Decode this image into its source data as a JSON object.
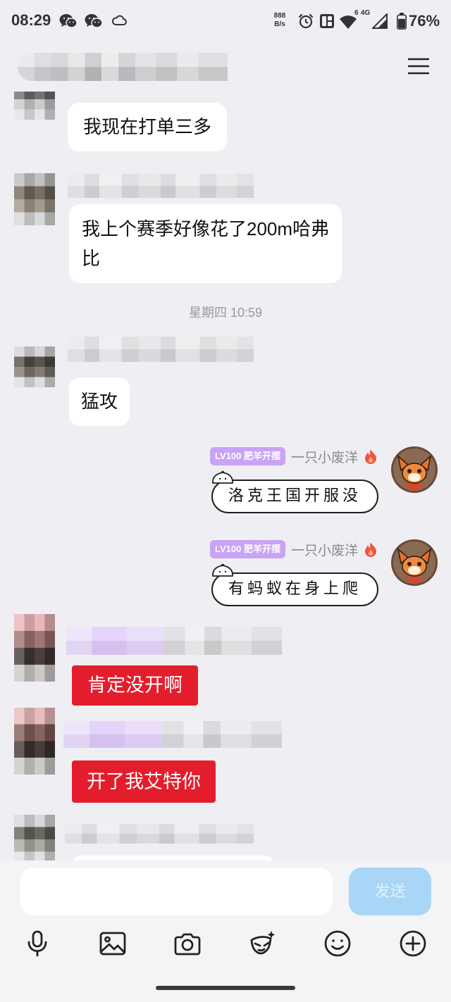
{
  "status_bar": {
    "time": "08:29",
    "net_speed_value": "888",
    "net_speed_unit": "B/s",
    "wifi_generation": "6",
    "network_type": "4G",
    "battery_percent": "76%",
    "battery_level": 0.76,
    "icons": [
      "wechat-icon",
      "wechat-icon",
      "cloud-icon",
      "alarm-icon",
      "dual-sim-icon",
      "wifi-icon",
      "signal-icon",
      "battery-icon"
    ]
  },
  "header": {
    "menu_icon": "hamburger-menu-icon"
  },
  "chat": [
    {
      "text": [
        "我现在打单三多"
      ]
    },
    {
      "text": [
        "我上个赛季好像花了200m哈弗",
        "比"
      ]
    },
    {
      "time": "星期四 10:59"
    },
    {
      "text": [
        "猛攻"
      ]
    },
    {
      "badge": "LV100 肥羊开摆",
      "sender": "一只小废洋",
      "sender_icon": "flame-icon",
      "text": [
        "洛克王国开服没"
      ]
    },
    {
      "badge": "LV100 肥羊开摆",
      "sender": "一只小废洋",
      "sender_icon": "flame-icon",
      "text": [
        "有蚂蚁在身上爬"
      ]
    },
    {
      "text": [
        "肯定没开啊"
      ]
    },
    {
      "text": [
        "开了我艾特你"
      ]
    },
    {
      "text": []
    }
  ],
  "input": {
    "value": "",
    "send_label": "发送"
  },
  "toolbar": {
    "icons": [
      "microphone-icon",
      "image-icon",
      "camera-icon",
      "face-mask-icon",
      "smiley-icon",
      "plus-icon"
    ]
  },
  "colors": {
    "page_bg": "#efeff3",
    "composer_bg": "#f4f4f6",
    "bubble_white": "#ffffff",
    "bubble_red": "#e41d2d",
    "badge_purple": "#c9a3f6",
    "send_button": "#a9d6f7",
    "send_label": "#e3f1fc",
    "name_gray": "#8a8a8e",
    "timestamp_gray": "#9a9a9e"
  }
}
